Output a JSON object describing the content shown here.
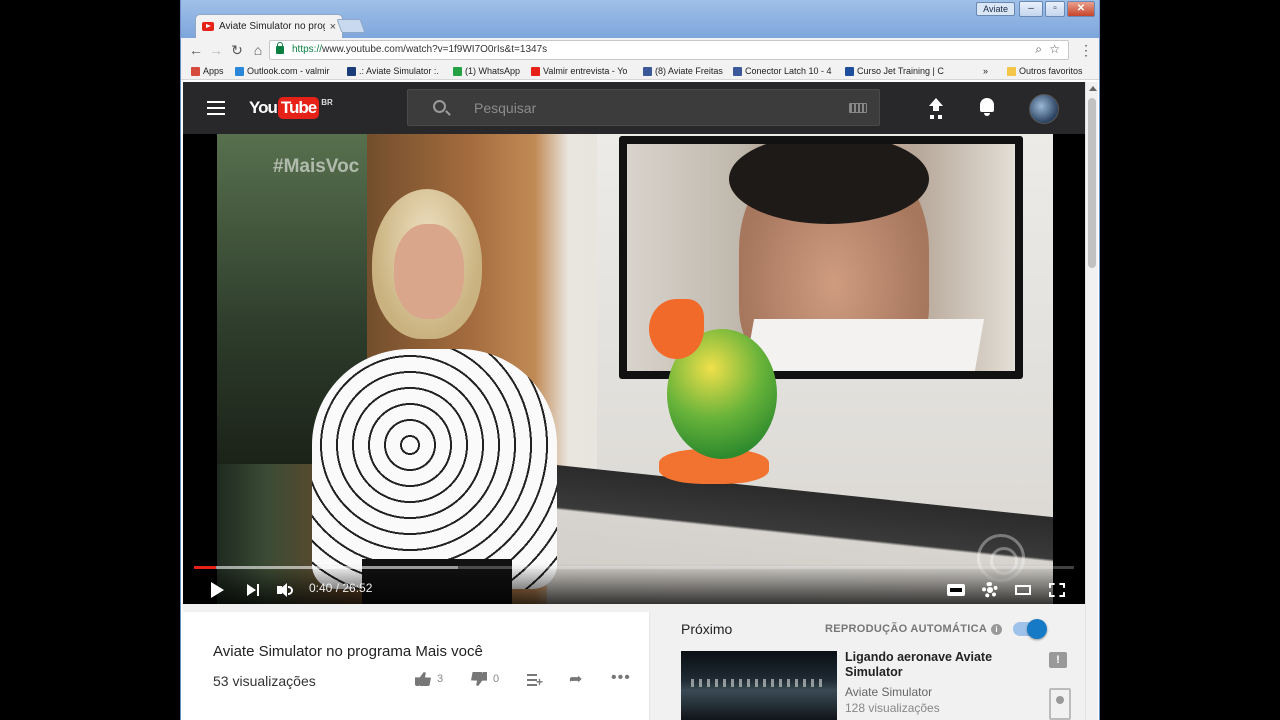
{
  "window": {
    "label": "Aviate",
    "min": "–",
    "max": "▫",
    "close": "✕"
  },
  "tab": {
    "title": "Aviate Simulator no prog",
    "close": "×"
  },
  "address": {
    "proto": "https://",
    "url_rest": "www.youtube.com/watch?v=1f9WI7O0rIs&t=1347s"
  },
  "bookmarks": [
    {
      "label": "Apps",
      "color": "#d54b3d"
    },
    {
      "label": "Outlook.com - valmir",
      "color": "#2b88d8"
    },
    {
      "label": ".: Aviate Simulator :.",
      "color": "#1a3c7a"
    },
    {
      "label": "(1) WhatsApp",
      "color": "#25a244"
    },
    {
      "label": "Valmir entrevista - Yo",
      "color": "#e62117"
    },
    {
      "label": "(8) Aviate Freitas",
      "color": "#3b5998"
    },
    {
      "label": "Conector Latch 10 - 4",
      "color": "#3b5998"
    },
    {
      "label": "Curso Jet Training | C",
      "color": "#1e4f9c"
    },
    {
      "label": "»",
      "color": ""
    },
    {
      "label": "Outros favoritos",
      "color": "#f3c64a"
    }
  ],
  "youtube": {
    "logo_you": "You",
    "logo_tube": "Tube",
    "region": "BR",
    "search_placeholder": "Pesquisar"
  },
  "player": {
    "watermark": "#MaisVoc",
    "time": "0:40 / 26:52",
    "played_fraction": 0.025,
    "buffered_fraction": 0.3
  },
  "video": {
    "title": "Aviate Simulator no programa Mais você",
    "views": "53 visualizações",
    "likes": "3",
    "dislikes": "0"
  },
  "sidebar": {
    "next_label": "Próximo",
    "autoplay_label": "REPRODUÇÃO AUTOMÁTICA",
    "info_glyph": "i",
    "feedback_glyph": "!",
    "recommendation": {
      "title": "Ligando aeronave Aviate Simulator",
      "channel": "Aviate Simulator",
      "views": "128 visualizações"
    }
  },
  "colors": {
    "brand_red": "#e62117",
    "accent_blue": "#167ac6",
    "header_bg": "#28282a"
  }
}
